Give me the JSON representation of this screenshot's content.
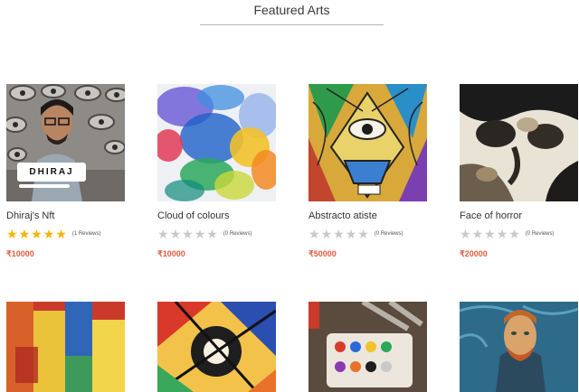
{
  "section": {
    "title": "Featured Arts"
  },
  "products": [
    {
      "name": "Dhiraj's Nft",
      "rating": 5,
      "reviews": "(1 Reviews)",
      "price": "₹10000",
      "badge": "DHIRAJ"
    },
    {
      "name": "Cloud of colours",
      "rating": 0,
      "reviews": "(0 Reviews)",
      "price": "₹10000"
    },
    {
      "name": "Abstracto atiste",
      "rating": 0,
      "reviews": "(0 Reviews)",
      "price": "₹50000"
    },
    {
      "name": "Face of horror",
      "rating": 0,
      "reviews": "(0 Reviews)",
      "price": "₹20000"
    }
  ],
  "colors": {
    "price": "#e45b3c",
    "star_filled": "#f4b400",
    "star_empty": "#c9c9c9"
  },
  "icons": {
    "star": "star-icon"
  }
}
